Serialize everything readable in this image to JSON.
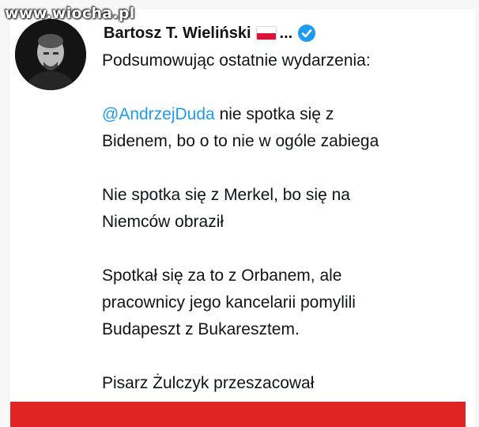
{
  "watermark": "www.wiocha.pl",
  "tweet": {
    "author_name": "Bartosz T. Wieliński",
    "ellipsis": "...",
    "flag_icon": "poland-flag-icon",
    "verified_icon": "verified-badge-icon",
    "colors": {
      "mention": "#1d9bf0",
      "banner": "#e02424",
      "text": "#0f1419"
    },
    "lines": {
      "intro": "Podsumowując ostatnie wydarzenia:",
      "mention": "@AndrzejDuda",
      "p1_rest": " nie spotka się z",
      "p1_line2": "Bidenem, bo o to nie w ogóle zabiega",
      "p2_line1": "Nie spotka się z Merkel, bo się na",
      "p2_line2": "Niemców obraził",
      "p3_line1": "Spotkał się za to z Orbanem, ale",
      "p3_line2": "pracownicy jego kancelarii pomylili",
      "p3_line3": "Budapeszt z Bukaresztem.",
      "p4_line1": "Pisarz Żulczyk przeszacował"
    }
  }
}
